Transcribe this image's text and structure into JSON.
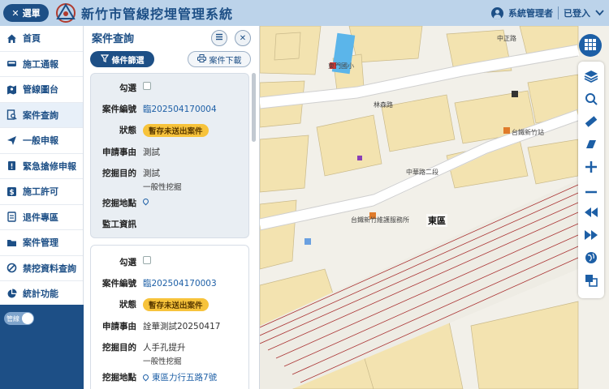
{
  "header": {
    "menu_label": "選單",
    "app_title": "新竹市管線挖埋管理系統",
    "user": "系統管理者",
    "login_status": "已登入"
  },
  "nav": {
    "items": [
      {
        "label": "首頁",
        "icon": "home-icon"
      },
      {
        "label": "施工通報",
        "icon": "truck-icon"
      },
      {
        "label": "管線圖台",
        "icon": "map-icon"
      },
      {
        "label": "案件查詢",
        "icon": "search-doc-icon"
      },
      {
        "label": "一般申報",
        "icon": "send-icon"
      },
      {
        "label": "緊急搶修申報",
        "icon": "urgent-doc-icon"
      },
      {
        "label": "施工許可",
        "icon": "dollar-icon"
      },
      {
        "label": "退件專區",
        "icon": "return-doc-icon"
      },
      {
        "label": "案件管理",
        "icon": "folder-icon"
      },
      {
        "label": "禁挖資料查詢",
        "icon": "ban-icon"
      },
      {
        "label": "統計功能",
        "icon": "pie-chart-icon"
      }
    ],
    "toggle_label": "管線"
  },
  "panel": {
    "title": "案件查詢",
    "filter_button": "條件篩選",
    "download_button": "案件下載",
    "labels": {
      "select": "勾選",
      "case_no": "案件編號",
      "status": "狀態",
      "reason": "申請事由",
      "purpose": "挖掘目的",
      "location": "挖掘地點",
      "supervisor": "監工資訊"
    },
    "cases": [
      {
        "case_no": "臨202504170004",
        "status": "暫存未送出案件",
        "reason": "測試",
        "purpose": "測試",
        "purpose_sub": "一般性挖掘",
        "location": "",
        "supervisor": ""
      },
      {
        "case_no": "臨202504170003",
        "status": "暫存未送出案件",
        "reason": "詮華測試20250417",
        "purpose": "人手孔提升",
        "purpose_sub": "一般性挖掘",
        "location": "東區力行五路7號"
      }
    ]
  },
  "map": {
    "labels": {
      "district": "東區",
      "road1": "林森路",
      "road2": "中華路二段",
      "poi1": "台鐵新竹站",
      "poi2": "台鐵新竹維護服務所",
      "poi3": "東門國小",
      "road3": "中正路"
    }
  },
  "colors": {
    "primary": "#1d4f86",
    "header_bg": "#bcd3ea",
    "badge": "#f7c33b",
    "map_bg": "#f2f0e9",
    "building": "#f3e3b0",
    "railway": "#a33"
  }
}
